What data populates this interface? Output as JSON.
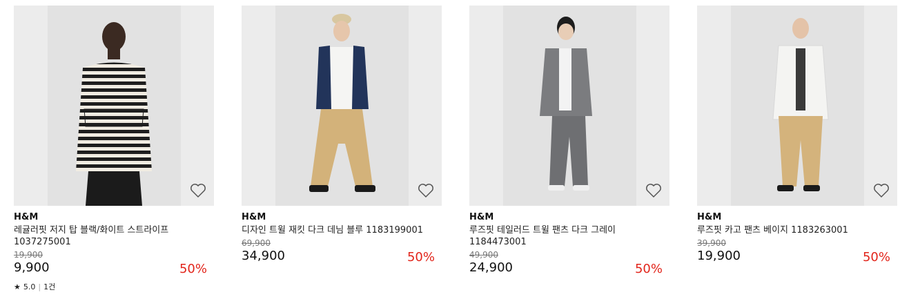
{
  "products": [
    {
      "brand": "H&M",
      "name": "레귤러핏 저지 탑 블랙/화이트 스트라이프 1037275001",
      "original_price": "19,900",
      "sale_price": "9,900",
      "discount": "50%",
      "rating": "5.0",
      "review_count": "1건",
      "top_color": "#f1ece2",
      "bottom_color": "#1b1b1b"
    },
    {
      "brand": "H&M",
      "name": "디자인 트윌 재킷 다크 데님 블루 1183199001",
      "original_price": "69,900",
      "sale_price": "34,900",
      "discount": "50%",
      "top_color": "#22345a",
      "bottom_color": "#d3b27a"
    },
    {
      "brand": "H&M",
      "name": "루즈핏 테일러드 트윌 팬츠 다크 그레이 1184473001",
      "original_price": "49,900",
      "sale_price": "24,900",
      "discount": "50%",
      "top_color": "#7b7c7f",
      "bottom_color": "#6e6f72"
    },
    {
      "brand": "H&M",
      "name": "루즈핏 카고 팬츠 베이지 1183263001",
      "original_price": "39,900",
      "sale_price": "19,900",
      "discount": "50%",
      "top_color": "#f4f4f2",
      "bottom_color": "#d4b37c"
    }
  ],
  "colors": {
    "discount": "#e2251b",
    "image_bg": "#ececec"
  },
  "icons": {
    "wishlist": "heart-outline-icon",
    "star": "star-icon"
  }
}
